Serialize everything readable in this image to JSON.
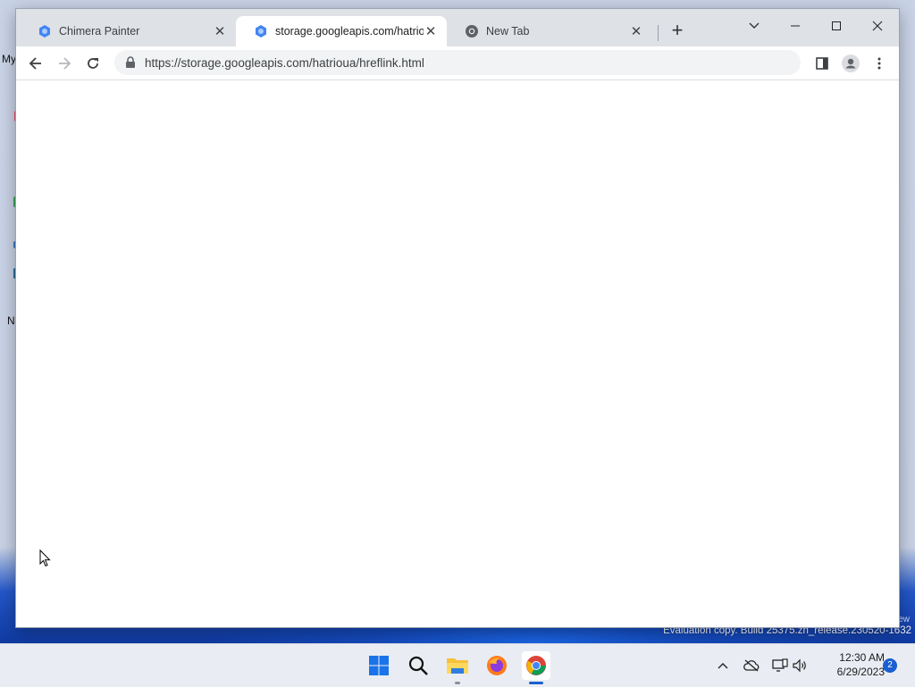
{
  "desktop": {
    "fragments": [
      "My",
      "N"
    ]
  },
  "browser": {
    "tabs": [
      {
        "title": "Chimera Painter",
        "active": false
      },
      {
        "title": "storage.googleapis.com/hatrioua",
        "active": true
      },
      {
        "title": "New Tab",
        "active": false
      }
    ],
    "new_tab_symbol": "+",
    "url": "https://storage.googleapis.com/hatrioua/hreflink.html"
  },
  "watermark": {
    "line": "Evaluation copy. Build 25375.zn_release.230520-1632",
    "partial": "ew"
  },
  "taskbar": {
    "apps": [
      "start-icon",
      "search-icon",
      "file-explorer-icon",
      "firefox-icon",
      "chrome-icon"
    ],
    "clock_time": "12:30 AM",
    "clock_date": "6/29/2023",
    "notification_count": "2"
  },
  "colors": {
    "accent": "#1a73e8",
    "titlebar": "#dee1e6",
    "taskbar": "#e9edf3"
  }
}
